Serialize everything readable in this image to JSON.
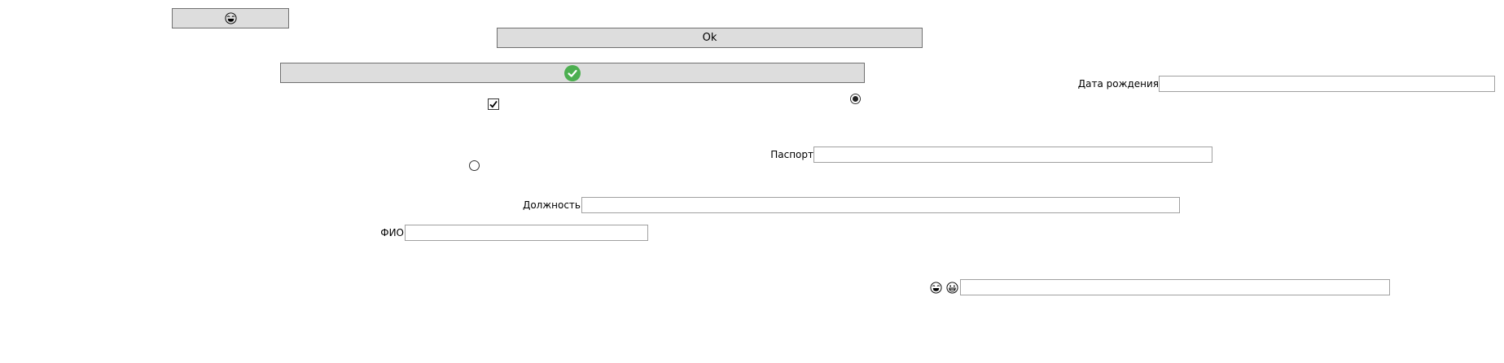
{
  "buttons": {
    "ok_label": "Ok"
  },
  "fields": {
    "birth_date": {
      "label": "Дата рождения",
      "value": ""
    },
    "passport": {
      "label": "Паспорт",
      "value": ""
    },
    "position": {
      "label": "Должность",
      "value": ""
    },
    "full_name": {
      "label": "ФИО",
      "value": ""
    },
    "emoji_text": {
      "value": ""
    }
  },
  "controls": {
    "checkbox_checked": true,
    "radio_top_selected": true,
    "radio_bottom_selected": false
  },
  "icons": {
    "top_button": "laughing-emoji-icon",
    "wide_button": "green-check-icon",
    "field_prefix_1": "laughing-emoji-icon",
    "field_prefix_2": "grinning-emoji-icon"
  },
  "colors": {
    "button_bg": "#dddddd",
    "accent_green": "#4caf50"
  }
}
